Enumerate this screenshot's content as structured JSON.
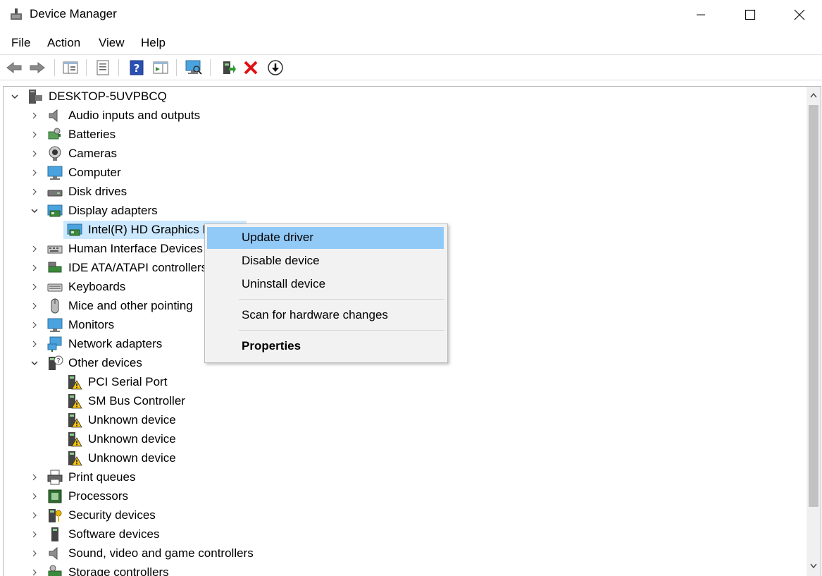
{
  "window": {
    "title": "Device Manager"
  },
  "menu": {
    "file": "File",
    "action": "Action",
    "view": "View",
    "help": "Help"
  },
  "toolbar_icons": [
    "back-arrow-icon",
    "forward-arrow-icon",
    "show-hide-console-tree-icon",
    "properties-icon",
    "help-icon",
    "action-pane-icon",
    "monitor-scan-icon",
    "update-driver-icon",
    "uninstall-icon",
    "enable-device-icon"
  ],
  "tree": {
    "root": "DESKTOP-5UVPBCQ",
    "categories": [
      {
        "label": "Audio inputs and outputs",
        "icon": "speaker-icon",
        "expanded": false
      },
      {
        "label": "Batteries",
        "icon": "battery-icon",
        "expanded": false
      },
      {
        "label": "Cameras",
        "icon": "camera-icon",
        "expanded": false
      },
      {
        "label": "Computer",
        "icon": "computer-icon",
        "expanded": false
      },
      {
        "label": "Disk drives",
        "icon": "disk-drive-icon",
        "expanded": false
      },
      {
        "label": "Display adapters",
        "icon": "display-adapter-icon",
        "expanded": true
      },
      {
        "label": "Intel(R) HD Graphics P",
        "icon": "display-adapter-icon",
        "child": true,
        "selected": true
      },
      {
        "label": "Human Interface Devices",
        "icon": "hid-icon",
        "expanded": false
      },
      {
        "label": "IDE ATA/ATAPI controllers",
        "icon": "ide-controller-icon",
        "expanded": false
      },
      {
        "label": "Keyboards",
        "icon": "keyboard-icon",
        "expanded": false
      },
      {
        "label": "Mice and other pointing",
        "icon": "mouse-icon",
        "expanded": false
      },
      {
        "label": "Monitors",
        "icon": "monitor-icon",
        "expanded": false
      },
      {
        "label": "Network adapters",
        "icon": "network-adapter-icon",
        "expanded": false
      },
      {
        "label": "Other devices",
        "icon": "unknown-device-icon",
        "expanded": true
      },
      {
        "label": "PCI Serial Port",
        "icon": "warning-device-icon",
        "child": true
      },
      {
        "label": "SM Bus Controller",
        "icon": "warning-device-icon",
        "child": true
      },
      {
        "label": "Unknown device",
        "icon": "warning-device-icon",
        "child": true
      },
      {
        "label": "Unknown device",
        "icon": "warning-device-icon",
        "child": true
      },
      {
        "label": "Unknown device",
        "icon": "warning-device-icon",
        "child": true
      },
      {
        "label": "Print queues",
        "icon": "printer-icon",
        "expanded": false
      },
      {
        "label": "Processors",
        "icon": "processor-icon",
        "expanded": false
      },
      {
        "label": "Security devices",
        "icon": "security-device-icon",
        "expanded": false
      },
      {
        "label": "Software devices",
        "icon": "software-device-icon",
        "expanded": false
      },
      {
        "label": "Sound, video and game controllers",
        "icon": "speaker-icon",
        "expanded": false
      },
      {
        "label": "Storage controllers",
        "icon": "storage-controller-icon",
        "expanded": false
      }
    ]
  },
  "context_menu": {
    "update_driver": "Update driver",
    "disable_device": "Disable device",
    "uninstall_device": "Uninstall device",
    "scan": "Scan for hardware changes",
    "properties": "Properties"
  },
  "colors": {
    "selection": "#cce8ff",
    "menu_highlight": "#91c9f7",
    "warning": "#f5c211"
  }
}
